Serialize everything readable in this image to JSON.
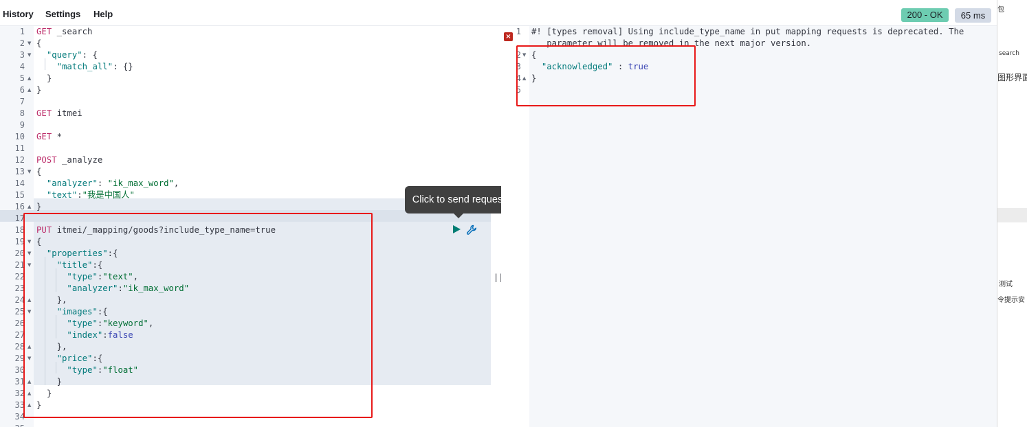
{
  "menu": {
    "history": "History",
    "settings": "Settings",
    "help": "Help"
  },
  "status": {
    "code": "200 - OK",
    "time": "65 ms"
  },
  "tooltip": {
    "send_request": "Click to send request"
  },
  "divider": {
    "handle": "||"
  },
  "request_editor": {
    "line_numbers": [
      "1",
      "2",
      "3",
      "4",
      "5",
      "6",
      "7",
      "8",
      "9",
      "10",
      "11",
      "12",
      "13",
      "14",
      "15",
      "16",
      "17",
      "18",
      "19",
      "20",
      "21",
      "22",
      "23",
      "24",
      "25",
      "26",
      "27",
      "28",
      "29",
      "30",
      "31",
      "32",
      "33",
      "34",
      "35"
    ],
    "tokens": {
      "l1_method": "GET",
      "l1_path": " _search",
      "l2": "{",
      "l3_key": "\"query\"",
      "l3_rest": ": {",
      "l4_key": "\"match_all\"",
      "l4_rest": ": {}",
      "l5": "}",
      "l6": "}",
      "l8_method": "GET",
      "l8_path": " itmei",
      "l10_method": "GET",
      "l10_path": " *",
      "l12_method": "POST",
      "l12_path": " _analyze",
      "l13": "{",
      "l14_key": "\"analyzer\"",
      "l14_colon": ": ",
      "l14_val": "\"ik_max_word\"",
      "l14_comma": ",",
      "l15_key": "\"text\"",
      "l15_colon": ":",
      "l15_val": "\"我是中国人\"",
      "l16": "}",
      "l18_method": "PUT",
      "l18_path": " itmei/_mapping/goods?include_type_name=true",
      "l19": "{",
      "l20_key": "\"properties\"",
      "l20_rest": ":{",
      "l21_key": "\"title\"",
      "l21_rest": ":{",
      "l22_key": "\"type\"",
      "l22_colon": ":",
      "l22_val": "\"text\"",
      "l22_comma": ",",
      "l23_key": "\"analyzer\"",
      "l23_colon": ":",
      "l23_val": "\"ik_max_word\"",
      "l24": "},",
      "l25_key": "\"images\"",
      "l25_rest": ":{",
      "l26_key": "\"type\"",
      "l26_colon": ":",
      "l26_val": "\"keyword\"",
      "l26_comma": ",",
      "l27_key": "\"index\"",
      "l27_colon": ":",
      "l27_val": "false",
      "l28": "},",
      "l29_key": "\"price\"",
      "l29_rest": ":{",
      "l30_key": "\"type\"",
      "l30_colon": ":",
      "l30_val": "\"float\"",
      "l31": "}",
      "l32": "}",
      "l33": "}"
    }
  },
  "response_editor": {
    "line_numbers": [
      "1",
      "2",
      "3",
      "4",
      "5"
    ],
    "warning_line1": "#! [types removal] Using include_type_name in put mapping requests is deprecated. The",
    "warning_line2": "   parameter will be removed in the next major version.",
    "l2": "{",
    "l3_key": "\"acknowledged\"",
    "l3_colon": " : ",
    "l3_val": "true",
    "l4": "}"
  },
  "background_window": {
    "t1": "包",
    "t2": "search",
    "t3": "图形界面",
    "t4": "测试",
    "t5": "令提示安"
  }
}
